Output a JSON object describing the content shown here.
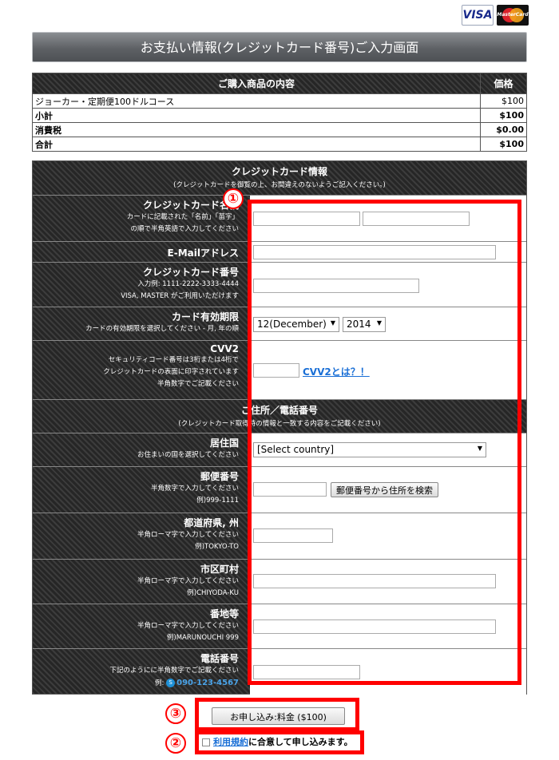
{
  "logos": {
    "visa": "VISA",
    "mastercard": "MasterCard"
  },
  "page_title": "お支払い情報(クレジットカード番号)ご入力画面",
  "products": {
    "header_item": "ご購入商品の内容",
    "header_price": "価格",
    "rows": [
      {
        "label": "ジョーカー・定期便100ドルコース",
        "price": "$100",
        "bold": false
      },
      {
        "label": "小計",
        "price": "$100",
        "bold": true
      },
      {
        "label": "消費税",
        "price": "$0.00",
        "bold": true
      },
      {
        "label": "合計",
        "price": "$100",
        "bold": true
      }
    ]
  },
  "card_section": {
    "title": "クレジットカード情報",
    "subtitle": "(クレジットカードを御覧の上、お間違えのないようご記入ください。)"
  },
  "fields": {
    "name": {
      "label": "クレジットカード名義",
      "help1": "カードに記載された「名前」「苗字」",
      "help2": "の順で半角英語で入力してください"
    },
    "email": {
      "label": "E-Mailアドレス"
    },
    "number": {
      "label": "クレジットカード番号",
      "help1": "入力例: 1111-2222-3333-4444",
      "help2": "VISA, MASTER がご利用いただけます"
    },
    "expiry": {
      "label": "カード有効期限",
      "help1": "カードの有効期限を選択してください - 月, 年の順",
      "month": "12(December)",
      "year": "2014"
    },
    "cvv": {
      "label": "CVV2",
      "help1": "セキュリティコード番号は3桁または4桁で",
      "help2": "クレジットカードの表面に印字されています",
      "help3": "半角数字でご記載ください",
      "link": "CVV2とは？！"
    }
  },
  "address_section": {
    "title": "ご住所／電話番号",
    "subtitle": "(クレジットカード取得時の情報と一致する内容をご記載ください)"
  },
  "address": {
    "country": {
      "label": "居住国",
      "help1": "お住まいの国を選択してください",
      "value": "[Select country]"
    },
    "zip": {
      "label": "郵便番号",
      "help1": "半角数字で入力してください",
      "help2": "例)999-1111",
      "button": "郵便番号から住所を検索"
    },
    "state": {
      "label": "都道府県, 州",
      "help1": "半角ローマ字で入力してください",
      "help2": "例)TOKYO-TO"
    },
    "city": {
      "label": "市区町村",
      "help1": "半角ローマ字で入力してください",
      "help2": "例)CHIYODA-KU"
    },
    "street": {
      "label": "番地等",
      "help1": "半角ローマ字で入力してください",
      "help2": "例)MARUNOUCHI 999"
    },
    "phone": {
      "label": "電話番号",
      "help1": "下記のようにに半角数字でご記載ください",
      "help2_prefix": "例:",
      "help2_number": "090-123-4567"
    }
  },
  "submit_button": "お申し込み:料金 ($100)",
  "agree": {
    "link": "利用規約",
    "text": "に合意して申し込みます。"
  },
  "annotations": {
    "n1": "①",
    "n2": "②",
    "n3": "③"
  },
  "colors": {
    "annotation": "#ff0000",
    "link": "#1a6fd6"
  }
}
